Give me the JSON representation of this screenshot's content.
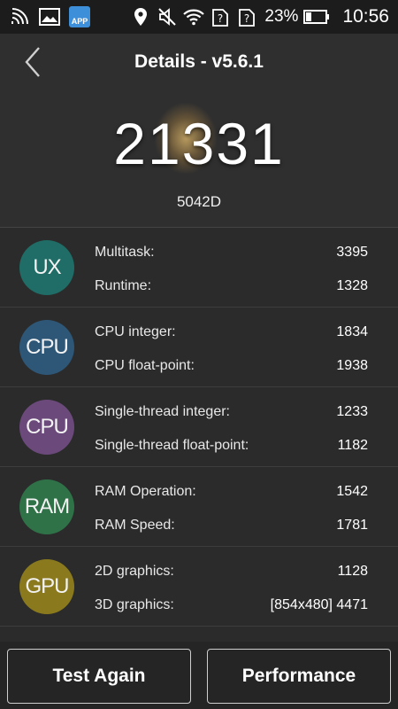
{
  "status_bar": {
    "battery_percent": "23%",
    "time": "10:56",
    "app_badge_text": "APP",
    "icons": [
      "wifi-signal-icon",
      "gallery-icon",
      "app-store-icon",
      "location-icon",
      "mute-icon",
      "wifi-icon",
      "no-sim-icon",
      "no-sim-icon",
      "battery-icon"
    ]
  },
  "header": {
    "title": "Details - v5.6.1"
  },
  "result": {
    "score": "21331",
    "device": "5042D"
  },
  "categories": [
    {
      "badge": "UX",
      "color": "#1f6d66",
      "items": [
        {
          "label": "Multitask:",
          "value": "3395"
        },
        {
          "label": "Runtime:",
          "value": "1328"
        }
      ]
    },
    {
      "badge": "CPU",
      "color": "#2e5777",
      "items": [
        {
          "label": "CPU integer:",
          "value": "1834"
        },
        {
          "label": "CPU float-point:",
          "value": "1938"
        }
      ]
    },
    {
      "badge": "CPU",
      "color": "#6b4a7b",
      "items": [
        {
          "label": "Single-thread integer:",
          "value": "1233"
        },
        {
          "label": "Single-thread float-point:",
          "value": "1182"
        }
      ]
    },
    {
      "badge": "RAM",
      "color": "#2f7248",
      "items": [
        {
          "label": "RAM Operation:",
          "value": "1542"
        },
        {
          "label": "RAM Speed:",
          "value": "1781"
        }
      ]
    },
    {
      "badge": "GPU",
      "color": "#8a7a1d",
      "items": [
        {
          "label": "2D graphics:",
          "value": "1128"
        },
        {
          "label": "3D graphics:",
          "value": "[854x480] 4471"
        }
      ]
    }
  ],
  "buttons": {
    "test_again": "Test Again",
    "performance": "Performance"
  }
}
